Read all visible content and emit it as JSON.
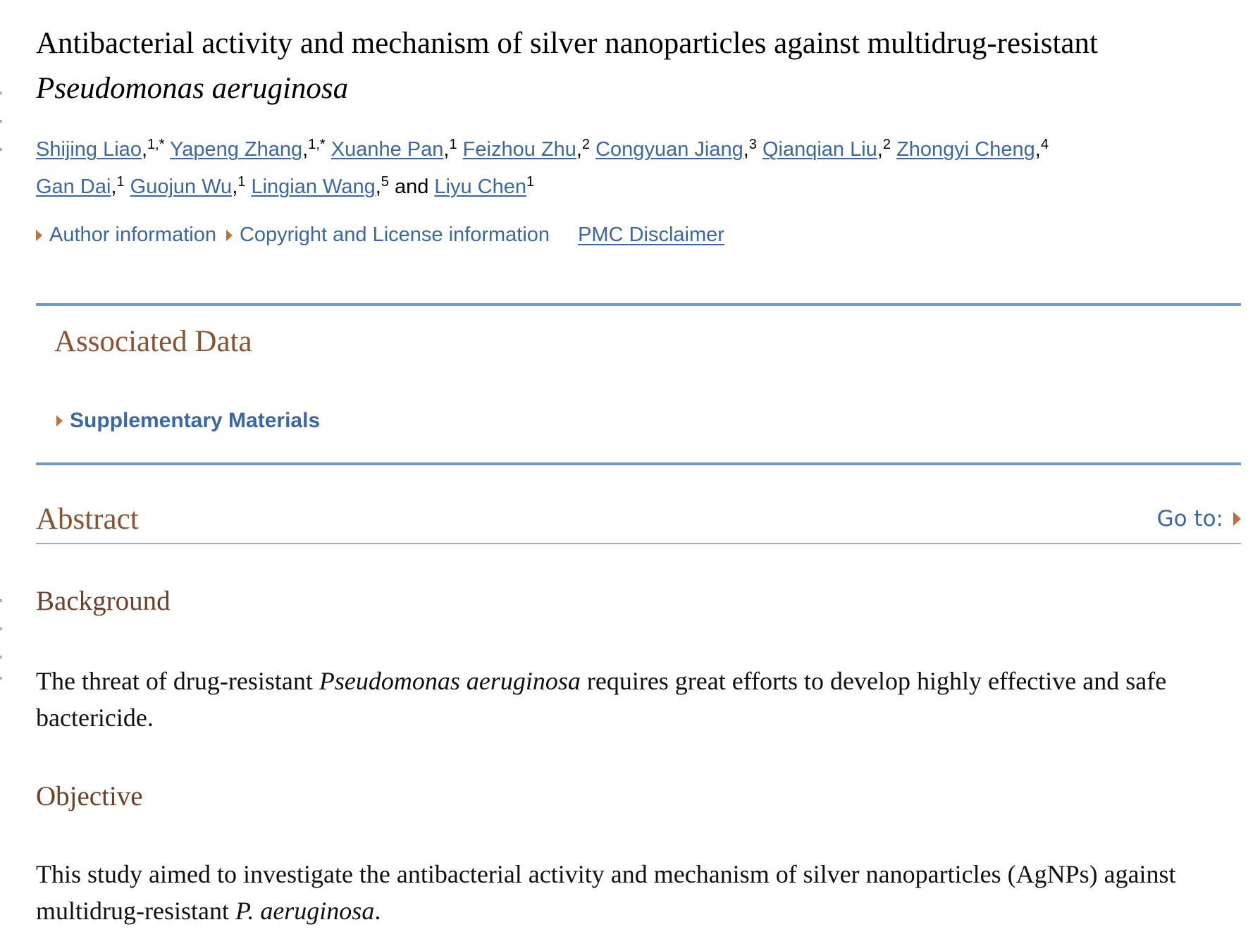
{
  "article": {
    "title_main": "Antibacterial activity and mechanism of silver nanoparticles against multidrug-resistant",
    "title_italic": "Pseudomonas aeruginosa",
    "authors": [
      {
        "name": "Shijing Liao",
        "sup": "1,*"
      },
      {
        "name": "Yapeng Zhang",
        "sup": "1,*"
      },
      {
        "name": "Xuanhe Pan",
        "sup": "1"
      },
      {
        "name": "Feizhou Zhu",
        "sup": "2"
      },
      {
        "name": "Congyuan Jiang",
        "sup": "3"
      },
      {
        "name": "Qianqian Liu",
        "sup": "2"
      },
      {
        "name": "Zhongyi Cheng",
        "sup": "4"
      },
      {
        "name": "Gan Dai",
        "sup": "1"
      },
      {
        "name": "Guojun Wu",
        "sup": "1"
      },
      {
        "name": "Lingian Wang",
        "sup": "5"
      },
      {
        "name": "Liyu Chen",
        "sup": "1"
      }
    ],
    "and_text": "and",
    "comma": ","
  },
  "meta_links": {
    "author_info": "Author information",
    "copyright": "Copyright and License information",
    "disclaimer": "PMC Disclaimer"
  },
  "associated_data": {
    "title": "Associated Data",
    "supplementary": "Supplementary Materials"
  },
  "abstract": {
    "title": "Abstract",
    "goto": "Go to:",
    "background": {
      "heading": "Background",
      "text_before": "The threat of drug-resistant ",
      "text_italic": "Pseudomonas aeruginosa",
      "text_after": " requires great efforts to develop highly effective and safe bactericide."
    },
    "objective": {
      "heading": "Objective",
      "text_before": "This study aimed to investigate the antibacterial activity and mechanism of silver nanoparticles (AgNPs) against multidrug-resistant ",
      "text_italic": "P. aeruginosa",
      "text_after": "."
    }
  },
  "colors": {
    "link": "#3a67a6",
    "section_heading": "#8b5230",
    "triangle": "#c0703f",
    "rule": "#7399c9"
  }
}
